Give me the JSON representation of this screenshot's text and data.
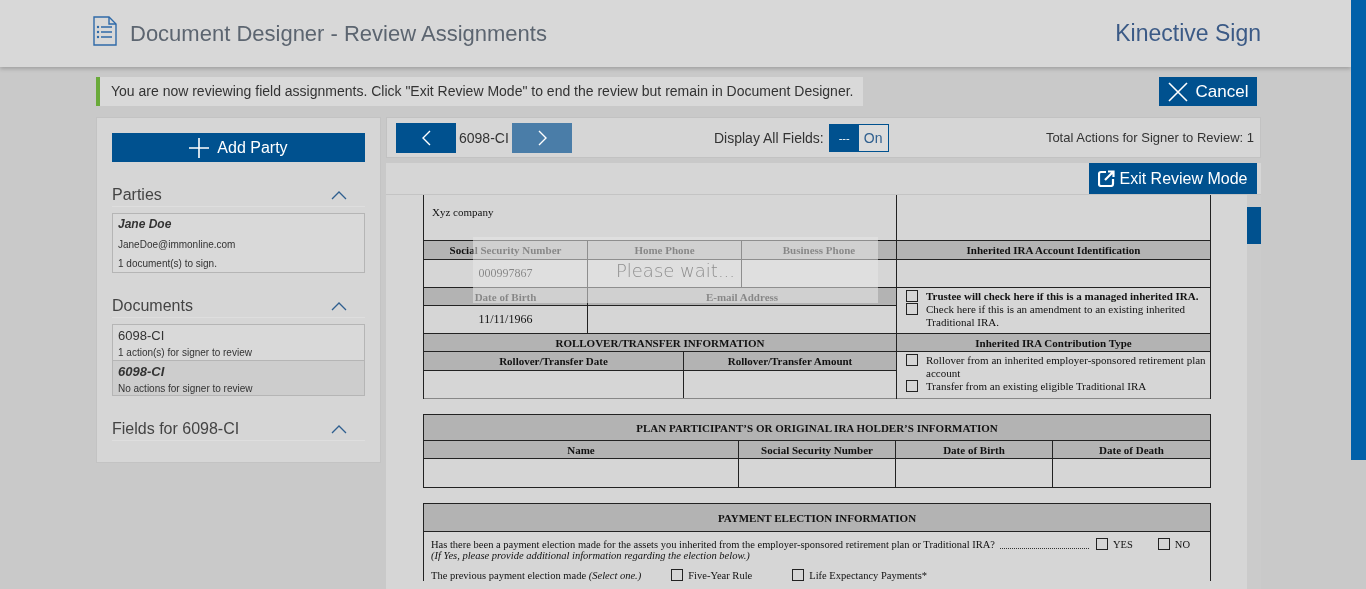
{
  "header": {
    "title": "Document Designer - Review Assignments",
    "brand": "Kinective Sign"
  },
  "notice": {
    "text": "You are now reviewing field assignments. Click \"Exit Review Mode\" to end the review but remain in Document Designer."
  },
  "cancel_button": "Cancel",
  "sidebar": {
    "add_party": "Add Party",
    "parties": {
      "title": "Parties",
      "expanded": true,
      "items": [
        {
          "name": "Jane Doe",
          "email": "JaneDoe@immonline.com",
          "detail": "1 document(s) to sign."
        }
      ]
    },
    "documents": {
      "title": "Documents",
      "expanded": true,
      "items": [
        {
          "name": "6098-CI",
          "detail": "1 action(s) for signer to review",
          "selected": false
        },
        {
          "name": "6098-CI",
          "detail": "No actions for signer to review",
          "selected": true
        }
      ]
    },
    "fields": {
      "title": "Fields for 6098-CI",
      "expanded": true
    }
  },
  "toolbar": {
    "document": "6098-CI",
    "nav": [
      {
        "kind": "prev",
        "disabled": false
      },
      {
        "kind": "next",
        "disabled": true
      }
    ],
    "display_all_fields": {
      "label": "Display All Fields:",
      "handle": "---",
      "value": "On",
      "on": true
    },
    "total_actions": "Total Actions for Signer to Review: 1"
  },
  "exit_review_button": "Exit Review Mode",
  "form": {
    "company": "Xyz company",
    "ssn_label": "Social Security Number",
    "home_phone_label": "Home Phone",
    "business_phone_label": "Business Phone",
    "ssn_value": "000997867",
    "dob_label": "Date of Birth",
    "email_label": "E-mail Address",
    "dob_value": "11/11/1966",
    "rollover_title": "ROLLOVER/TRANSFER INFORMATION",
    "rollover_date_label": "Rollover/Transfer Date",
    "rollover_amount_label": "Rollover/Transfer Amount",
    "account_title": "Inherited IRA Account Identification",
    "account_checks": [
      {
        "text": "Trustee will check here if this is a managed inherited IRA.",
        "emphasis": true,
        "checked": false
      },
      {
        "text": "Check here if this is an amendment to an existing inherited Traditional IRA.",
        "emphasis": false,
        "checked": false
      }
    ],
    "contribution_title": "Inherited IRA Contribution Type",
    "contribution_checks": [
      {
        "text": "Rollover from an inherited employer-sponsored retirement plan account",
        "emphasis": false,
        "checked": false
      },
      {
        "text": "Transfer from an existing eligible Traditional IRA",
        "emphasis": false,
        "checked": false
      }
    ],
    "participant_title": "PLAN PARTICIPANT’S OR ORIGINAL IRA HOLDER’S INFORMATION",
    "participant_columns": [
      "Name",
      "Social Security Number",
      "Date of Birth",
      "Date of Death"
    ],
    "payment_title": "PAYMENT ELECTION INFORMATION",
    "payment_question": "Has there been a payment election made for the assets you inherited from the employer-sponsored retirement plan or Traditional IRA?",
    "payment_answers": [
      {
        "label": "YES",
        "checked": false
      },
      {
        "label": "NO",
        "checked": false
      }
    ],
    "payment_note": "(If Yes, please provide additional information regarding the election below.)",
    "previous_label": "The previous payment election made *(Select one.)*",
    "previous_options": [
      {
        "label": "Five-Year Rule",
        "checked": false
      },
      {
        "label": "Life Expectancy Payments*",
        "checked": false
      }
    ]
  },
  "loading": {
    "text": "Please wait..."
  }
}
